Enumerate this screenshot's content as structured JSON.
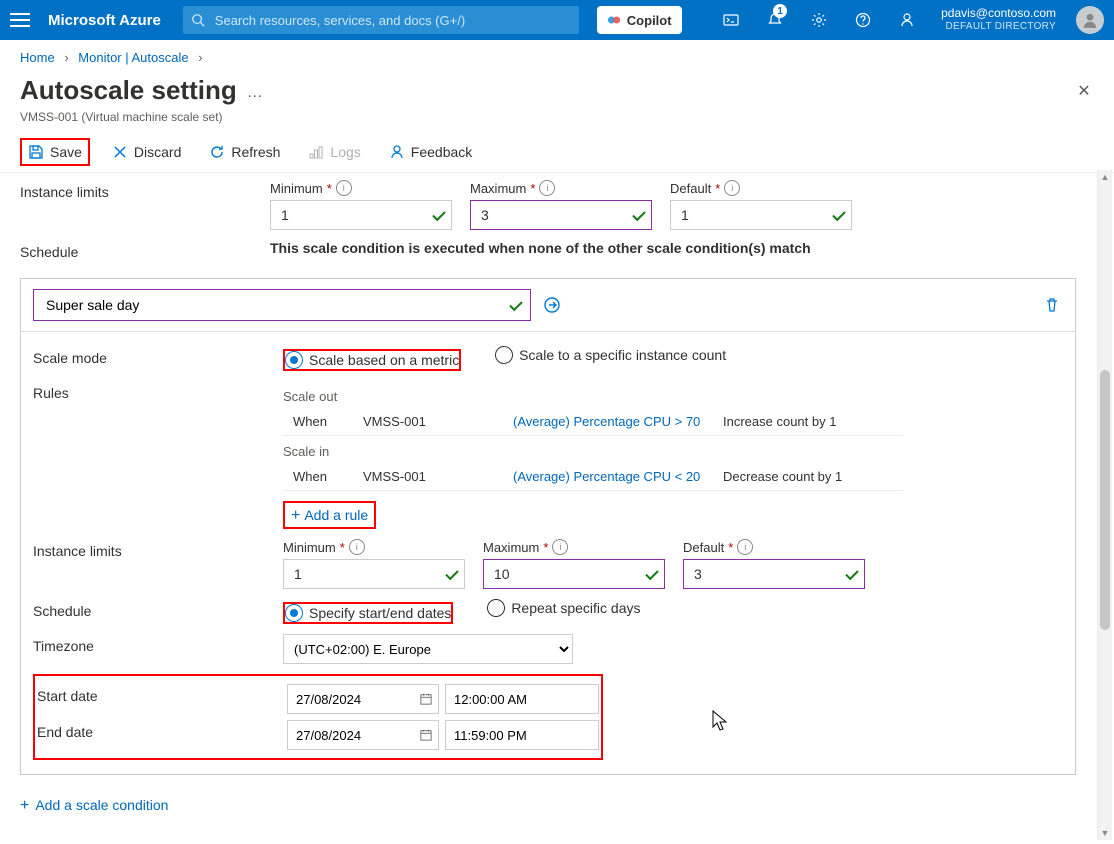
{
  "brand": "Microsoft Azure",
  "search_placeholder": "Search resources, services, and docs (G+/)",
  "copilot_label": "Copilot",
  "notif_count": "1",
  "user_email": "pdavis@contoso.com",
  "user_dir": "DEFAULT DIRECTORY",
  "crumbs": {
    "home": "Home",
    "monitor": "Monitor | Autoscale"
  },
  "page_title": "Autoscale setting",
  "page_sub": "VMSS-001 (Virtual machine scale set)",
  "toolbar": {
    "save": "Save",
    "discard": "Discard",
    "refresh": "Refresh",
    "logs": "Logs",
    "feedback": "Feedback"
  },
  "top": {
    "instance_limits": "Instance limits",
    "min_label": "Minimum",
    "max_label": "Maximum",
    "def_label": "Default",
    "min_val": "1",
    "max_val": "3",
    "def_val": "1",
    "schedule_label": "Schedule",
    "schedule_text": "This scale condition is executed when none of the other scale condition(s) match"
  },
  "cond": {
    "name": "Super sale day",
    "scale_mode_label": "Scale mode",
    "mode_metric": "Scale based on a metric",
    "mode_count": "Scale to a specific instance count",
    "rules_label": "Rules",
    "scale_out": "Scale out",
    "scale_in": "Scale in",
    "when": "When",
    "resource": "VMSS-001",
    "out_cond": "(Average) Percentage CPU > 70",
    "out_action": "Increase count by 1",
    "in_cond": "(Average) Percentage CPU < 20",
    "in_action": "Decrease count by 1",
    "add_rule": "Add a rule",
    "instance_limits": "Instance limits",
    "min_label": "Minimum",
    "max_label": "Maximum",
    "def_label": "Default",
    "min_val": "1",
    "max_val": "10",
    "def_val": "3",
    "schedule_label": "Schedule",
    "sched_specify": "Specify start/end dates",
    "sched_repeat": "Repeat specific days",
    "tz_label": "Timezone",
    "tz_value": "(UTC+02:00) E. Europe",
    "start_label": "Start date",
    "start_date": "27/08/2024",
    "start_time": "12:00:00 AM",
    "end_label": "End date",
    "end_date": "27/08/2024",
    "end_time": "11:59:00 PM"
  },
  "add_condition": "Add a scale condition"
}
